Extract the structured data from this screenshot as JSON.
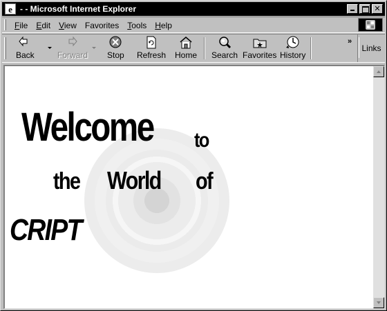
{
  "window": {
    "title": "- - Microsoft Internet Explorer",
    "app_icon": "internet-explorer-icon",
    "controls": [
      "minimize-icon",
      "maximize-icon",
      "close-icon"
    ]
  },
  "menubar": {
    "items": [
      {
        "label": "File",
        "accel": "F",
        "rest": "ile"
      },
      {
        "label": "Edit",
        "accel": "E",
        "rest": "dit"
      },
      {
        "label": "View",
        "accel": "V",
        "rest": "iew"
      },
      {
        "label": "Favorites",
        "accel": "",
        "rest": "Favorites"
      },
      {
        "label": "Tools",
        "accel": "T",
        "rest": "ools"
      },
      {
        "label": "Help",
        "accel": "H",
        "rest": "elp"
      }
    ]
  },
  "toolbar": {
    "back": "Back",
    "forward": "Forward",
    "stop": "Stop",
    "refresh": "Refresh",
    "home": "Home",
    "search": "Search",
    "favorites": "Favorites",
    "history": "History",
    "overflow": "»",
    "links": "Links"
  },
  "page": {
    "welcome": "Welcome",
    "to": "to",
    "the": "the",
    "world": "World",
    "of": "of",
    "script": "CRIPT"
  },
  "close_glyph": "✕"
}
